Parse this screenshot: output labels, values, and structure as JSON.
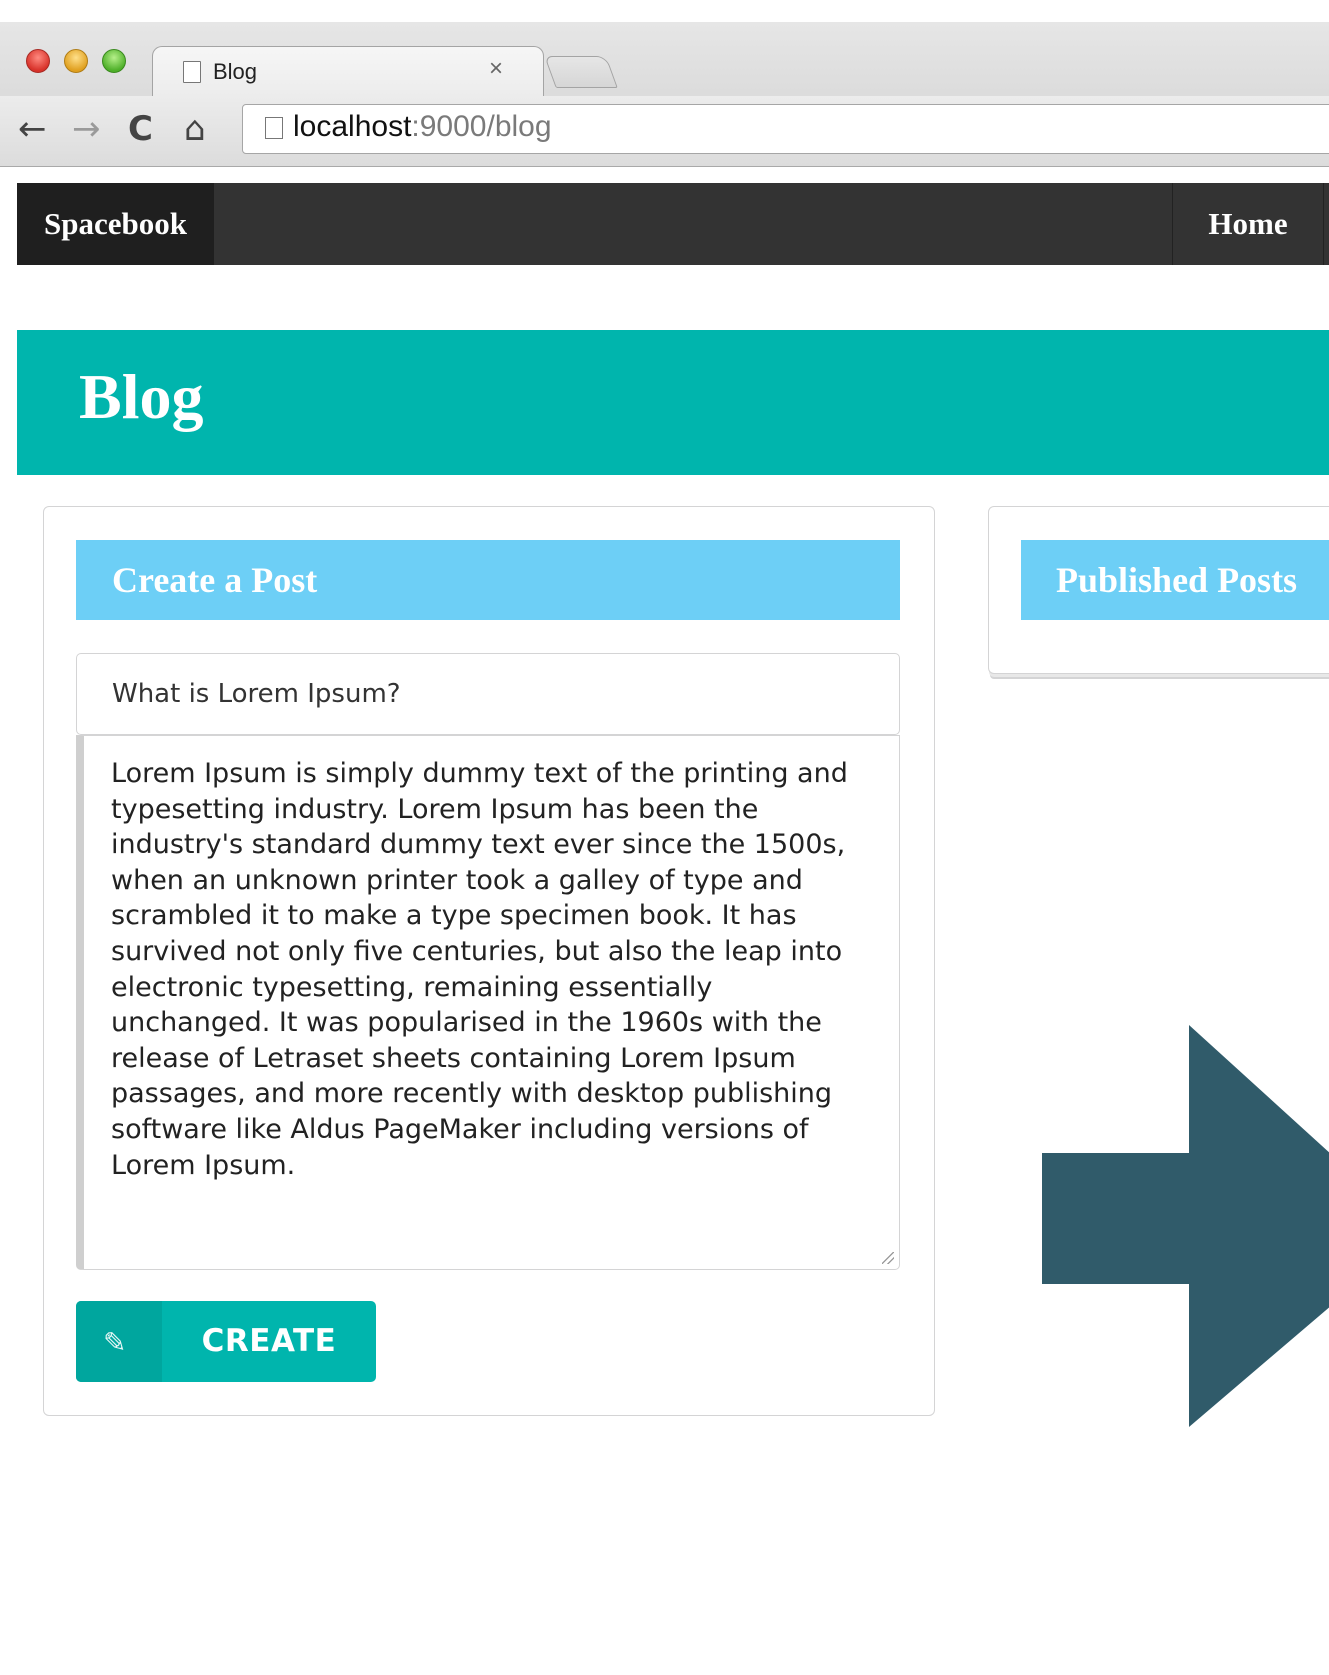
{
  "browser": {
    "tab_title": "Blog",
    "tab_close": "×",
    "url_host": "localhost",
    "url_rest": ":9000/blog"
  },
  "navbar": {
    "brand": "Spacebook",
    "home": "Home"
  },
  "banner": {
    "title": "Blog"
  },
  "create_post": {
    "header": "Create a Post",
    "title_value": "What is Lorem Ipsum?",
    "body_value": "Lorem Ipsum is simply dummy text of the printing and typesetting industry. Lorem Ipsum has been the industry's standard dummy text ever since the 1500s, when an unknown printer took a galley of type and scrambled it to make a type specimen book. It has survived not only five centuries, but also the leap into electronic typesetting, remaining essentially unchanged. It was popularised in the 1960s with the release of Letraset sheets containing Lorem Ipsum passages, and more recently with desktop publishing software like Aldus PageMaker including versions of Lorem Ipsum.",
    "button_label": "CREATE",
    "button_icon": "edit-icon"
  },
  "published_posts": {
    "header": "Published Posts"
  },
  "colors": {
    "navbar_bg": "#333333",
    "banner_bg": "#00b5ad",
    "header_bar_bg": "#6dcff6",
    "arrow": "#305b6a"
  }
}
